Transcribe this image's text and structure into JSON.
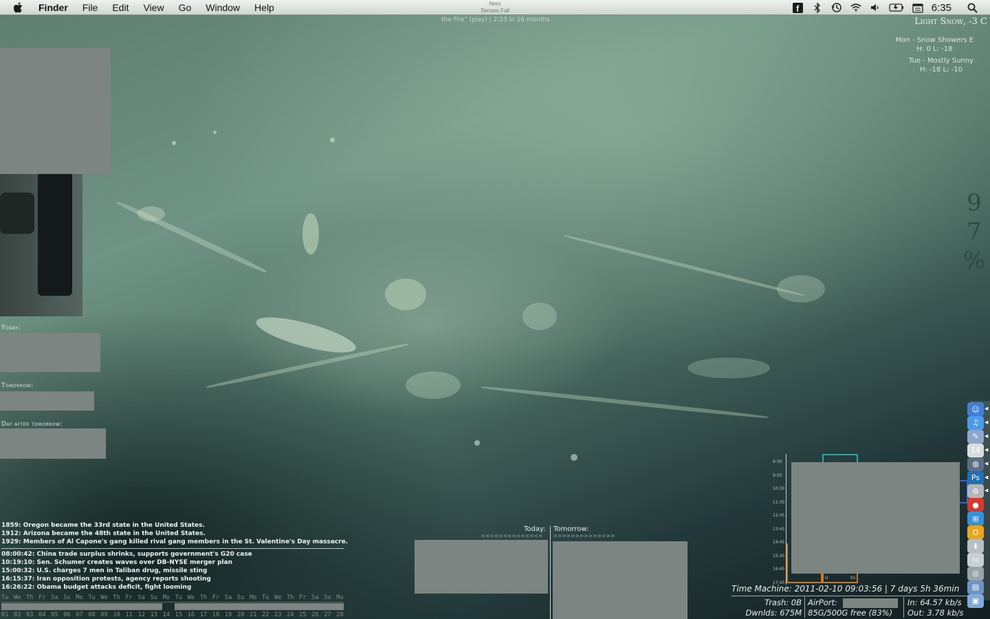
{
  "menubar": {
    "app_name": "Finder",
    "menus": [
      "File",
      "Edit",
      "View",
      "Go",
      "Window",
      "Help"
    ],
    "now_playing": {
      "title": "Nero",
      "artist": "Senses Fail"
    },
    "clock": "6:35"
  },
  "track_info": "the Fire\" (play) | 2:23 in 16 months",
  "weather": {
    "current": "Light Snow, -3 C",
    "forecast": [
      {
        "day_line": "Mon - Snow Showers E",
        "temps": "H: 0  L: -18"
      },
      {
        "day_line": "Tue - Mostly Sunny",
        "temps": "H: -18  L: -10"
      }
    ]
  },
  "humidity": {
    "d1": "9",
    "d2": "7",
    "pct": "%"
  },
  "calendar_labels": {
    "today": "Today:",
    "tomorrow": "Tomorrow:",
    "day_after": "Day after tomorrow:"
  },
  "history": [
    "1859: Oregon became the 33rd state in the United States.",
    "1912: Arizona became the 48th state in the United States.",
    "1929: Members of Al Capone's gang killed rival gang members in the St. Valentine's Day massacre."
  ],
  "news": [
    "08:00:42: China trade surplus shrinks, supports government's G20 case",
    "10:19:10: Sen. Schumer creates waves over DB-NYSE merger plan",
    "15:00:32: U.S. charges 7 men in Taliban drug, missile sting",
    "16:15:37: Iran opposition protests, agency reports shooting",
    "16:26:22: Obama budget attacks deficit, fight looming"
  ],
  "month_strip": {
    "weekdays": [
      "Tu",
      "We",
      "Th",
      "Fr",
      "Sa",
      "Su",
      "Mo",
      "Tu",
      "We",
      "Th",
      "Fr",
      "Sa",
      "Su",
      "Mo",
      "Tu",
      "We",
      "Th",
      "Fr",
      "Sa",
      "Su",
      "Mo",
      "Tu",
      "We",
      "Th",
      "Fr",
      "Sa",
      "Su",
      "Mo"
    ],
    "days": [
      "01",
      "02",
      "03",
      "04",
      "05",
      "06",
      "07",
      "08",
      "09",
      "10",
      "11",
      "12",
      "13",
      "14",
      "15",
      "16",
      "17",
      "18",
      "19",
      "20",
      "21",
      "22",
      "23",
      "24",
      "25",
      "26",
      "27",
      "28"
    ]
  },
  "ical": {
    "today_label": "Today:",
    "tomorrow_label": "Tomorrow:",
    "today_arrows": "<<<<<<<<<<<<<<",
    "tomorrow_arrows": ">>>>>>>>>>>>>>"
  },
  "graph": {
    "times": [
      "9:30",
      "9:50",
      "10:30",
      "11:30",
      "12:45",
      "13:45",
      "14:45",
      "15:45",
      "16:45",
      "17:45"
    ],
    "bottom_labels": [
      "U",
      "01"
    ]
  },
  "system": {
    "time_machine": "Time Machine: 2011-02-10 09:03:56 | 7 days 5h 36min",
    "trash": "Trash: 0B",
    "downloads": "Dwnlds: 675M",
    "airport_label": "AirPort:",
    "disk": "85G/500G free (83%)",
    "net_in": "In: 64.57 kb/s",
    "net_out": "Out: 3.78 kb/s"
  },
  "dock": [
    "finder-icon",
    "itunes-icon",
    "preview-icon",
    "calendar-icon",
    "network-icon",
    "photoshop-icon",
    "system-prefs-icon",
    "apple-icon",
    "windows-icon",
    "opera-icon",
    "downloads-icon",
    "harddisk-icon",
    "settings-icon",
    "desktop-icon",
    "folder-icon"
  ],
  "colors": {
    "menubar": "#dfe5e1",
    "redacted": "#7c8582",
    "graph_orange": "#c87a2a",
    "graph_teal": "#2aa6a6",
    "graph_blue": "#3a5fd0"
  }
}
